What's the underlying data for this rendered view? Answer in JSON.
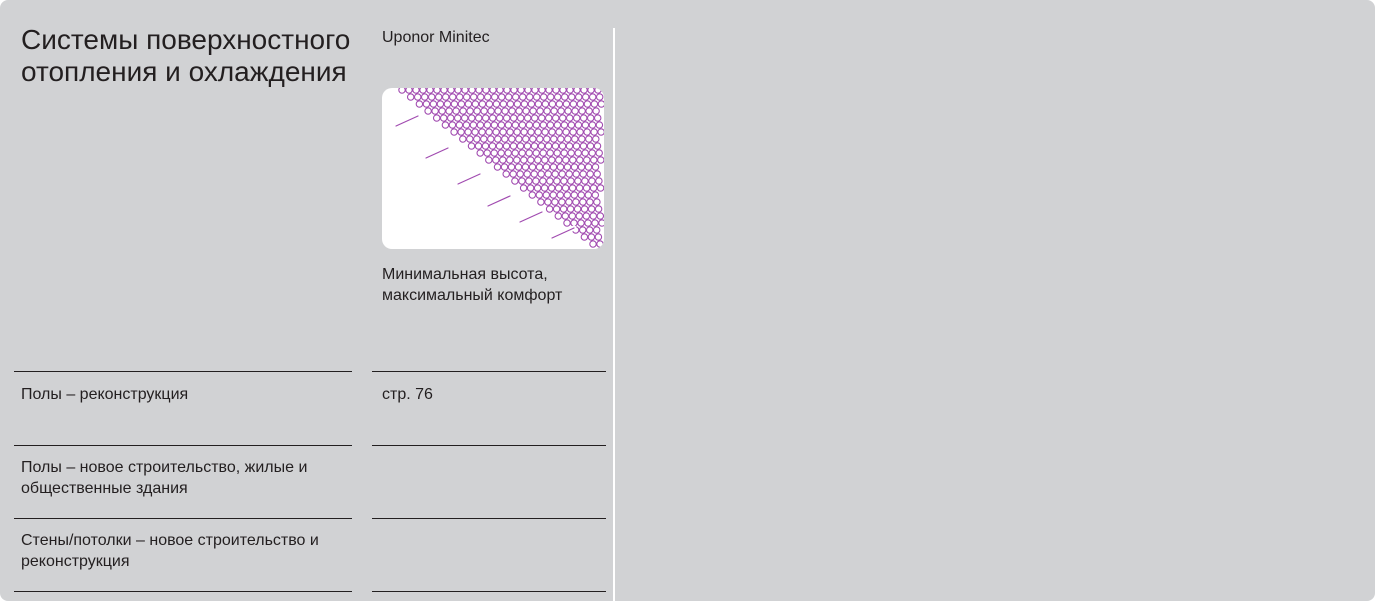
{
  "header": {
    "title": "Системы поверхностного отопления и охлаждения",
    "product_name": "Uponor Minitec",
    "product_image_icon": "minitec-panel-image",
    "product_description": "Минимальная высота, максимальный комфорт"
  },
  "rows": [
    {
      "label": "Полы – реконструкция",
      "value": "стр. 76"
    },
    {
      "label": "Полы – новое строительство, жилые и общественные здания",
      "value": ""
    },
    {
      "label": "Стены/потолки – новое строительство и реконструкция",
      "value": ""
    }
  ],
  "colors": {
    "background": "#d1d2d4",
    "text": "#231f20",
    "accent": "#a14bb0"
  }
}
